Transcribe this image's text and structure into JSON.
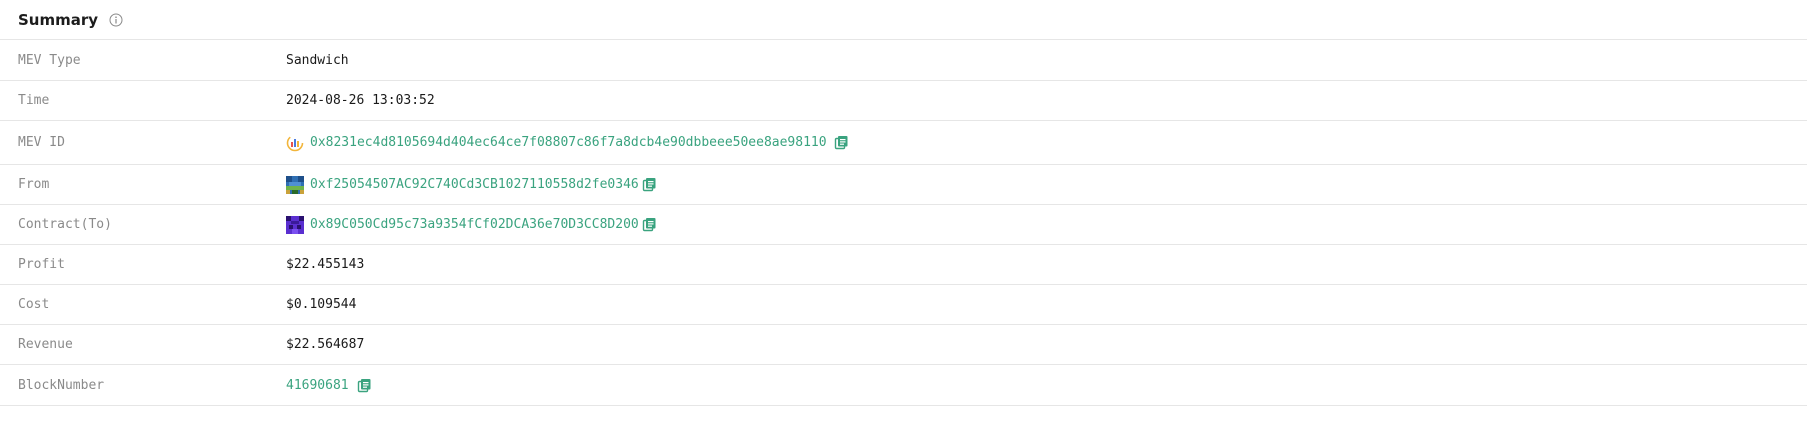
{
  "summary": {
    "title": "Summary"
  },
  "rows": {
    "mev_type": {
      "label": "MEV Type",
      "value": "Sandwich"
    },
    "time": {
      "label": "Time",
      "value": "2024-08-26 13:03:52"
    },
    "mev_id": {
      "label": "MEV ID",
      "value": "0x8231ec4d8105694d404ec64ce7f08807c86f7a8dcb4e90dbbeee50ee8ae98110"
    },
    "from": {
      "label": "From",
      "value": "0xf25054507AC92C740Cd3CB1027110558d2fe0346"
    },
    "contract": {
      "label": "Contract(To)",
      "value": "0x89C050Cd95c73a9354fCf02DCA36e70D3CC8D200"
    },
    "profit": {
      "label": "Profit",
      "value": "$22.455143"
    },
    "cost": {
      "label": "Cost",
      "value": "$0.109544"
    },
    "revenue": {
      "label": "Revenue",
      "value": "$22.564687"
    },
    "block_number": {
      "label": "BlockNumber",
      "value": "41690681"
    }
  },
  "colors": {
    "link": "#3aa37f",
    "label": "#8a8a8a",
    "divider": "#e6e6e6"
  },
  "icons": {
    "info": "info-icon",
    "copy": "copy-icon",
    "mev_logo": "mev-logo-icon",
    "from_avatar": "address-avatar-icon",
    "contract_avatar": "contract-avatar-icon"
  }
}
